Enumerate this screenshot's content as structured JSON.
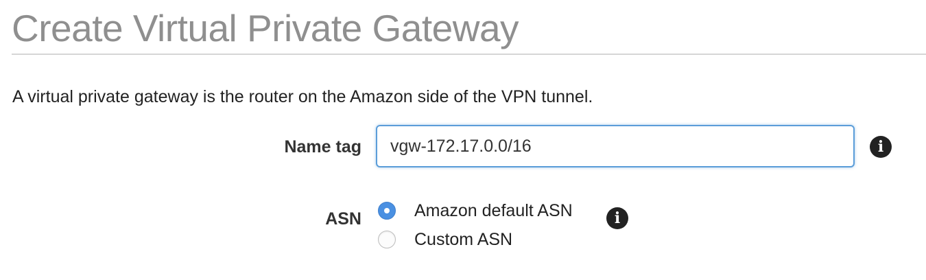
{
  "header": {
    "title": "Create Virtual Private Gateway"
  },
  "description": "A virtual private gateway is the router on the Amazon side of the VPN tunnel.",
  "form": {
    "name_tag": {
      "label": "Name tag",
      "value": "vgw-172.17.0.0/16",
      "info_icon": "info-icon"
    },
    "asn": {
      "label": "ASN",
      "info_icon": "info-icon",
      "options": [
        {
          "label": "Amazon default ASN",
          "selected": true
        },
        {
          "label": "Custom ASN",
          "selected": false
        }
      ]
    }
  },
  "colors": {
    "title": "#8f8f8f",
    "accent": "#4a90e2",
    "focus_border": "#5b9dd9",
    "icon": "#222222"
  }
}
